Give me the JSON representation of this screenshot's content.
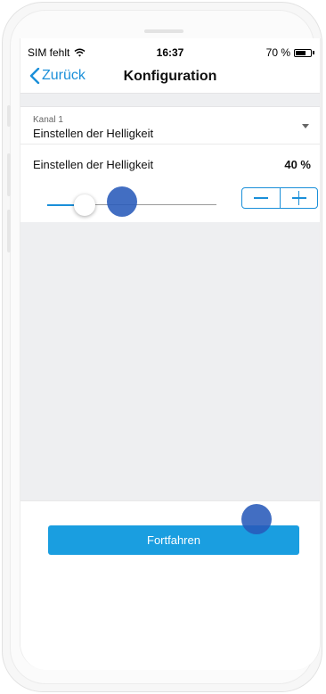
{
  "status_bar": {
    "carrier": "SIM fehlt",
    "time": "16:37",
    "battery_percent": "70 %",
    "battery_level": 0.7,
    "wifi_icon": "wifi-icon"
  },
  "navbar": {
    "back_label": "Zurück",
    "title": "Konfiguration"
  },
  "channel_select": {
    "label": "Kanal 1",
    "value": "Einstellen der Helligkeit"
  },
  "brightness": {
    "label": "Einstellen der Helligkeit",
    "value_text": "40 %",
    "slider_value": 0.22
  },
  "stepper": {
    "minus_icon": "minus-icon",
    "plus_icon": "plus-icon"
  },
  "footer": {
    "continue_label": "Fortfahren"
  },
  "colors": {
    "accent": "#1a8fd9",
    "button": "#1a9ee0",
    "touch_indicator": "#2d5db9",
    "background_gray": "#eeeff1"
  }
}
